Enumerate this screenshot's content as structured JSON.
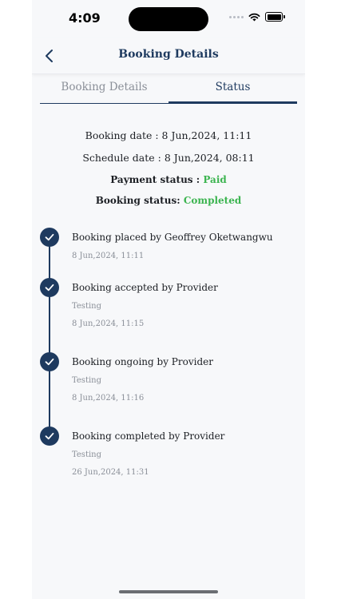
{
  "status_bar": {
    "time": "4:09"
  },
  "header": {
    "title": "Booking Details"
  },
  "tabs": [
    {
      "label": "Booking Details"
    },
    {
      "label": "Status"
    }
  ],
  "info": {
    "booking_date": "Booking date : 8 Jun,2024, 11:11",
    "schedule_date": "Schedule date : 8 Jun,2024, 08:11",
    "payment_status_label": "Payment status :",
    "payment_status_value": "Paid",
    "booking_status_label": "Booking status:",
    "booking_status_value": "Completed"
  },
  "timeline": [
    {
      "title": "Booking placed by Geoffrey Oketwangwu",
      "note": "",
      "date": "8 Jun,2024, 11:11"
    },
    {
      "title": "Booking accepted by Provider",
      "note": "Testing",
      "date": "8 Jun,2024, 11:15"
    },
    {
      "title": "Booking ongoing by Provider",
      "note": "Testing",
      "date": "8 Jun,2024, 11:16"
    },
    {
      "title": "Booking completed by Provider",
      "note": "Testing",
      "date": "26 Jun,2024, 11:31"
    }
  ],
  "colors": {
    "primary": "#1e3a5f",
    "success": "#3bb44f",
    "muted": "#8a8f98",
    "background": "#f7f8fa"
  }
}
